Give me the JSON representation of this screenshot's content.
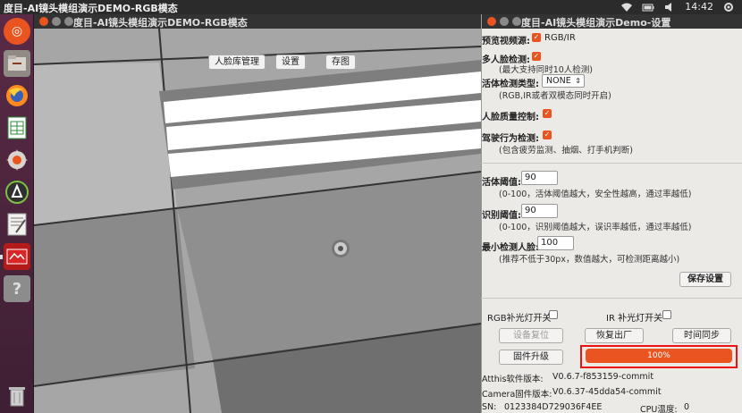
{
  "topbar": {
    "title": "度目-AI镜头模组演示DEMO-RGB模态",
    "clock": "14:42"
  },
  "cam_window": {
    "title": "度目-AI镜头模组演示DEMO-RGB模态",
    "buttons": {
      "face_db": "人脸库管理",
      "settings": "设置",
      "save_image": "存图"
    }
  },
  "settings_window": {
    "title": "度目-AI镜头模组演示Demo-设置",
    "preview_source_label": "预览视频源:",
    "preview_source_value": "RGB/IR",
    "multi_face_label": "多人脸检测:",
    "multi_face_hint": "(最大支持同时10人检测)",
    "liveness_type_label": "活体检测类型:",
    "liveness_type_value": "NONE",
    "liveness_type_hint": "(RGB,IR或者双模态同时开启)",
    "face_quality_label": "人脸质量控制:",
    "driving_label": "驾驶行为检测:",
    "driving_hint": "(包含疲劳监测、抽烟、打手机判断)",
    "liveness_threshold_label": "活体阈值:",
    "liveness_threshold_value": "90",
    "liveness_threshold_hint": "(0-100，活体阈值越大，安全性越高，通过率越低)",
    "recog_threshold_label": "识别阈值:",
    "recog_threshold_value": "90",
    "recog_threshold_hint": "(0-100，识别阈值越大，误识率越低，通过率越低)",
    "min_face_label": "最小检测人脸:",
    "min_face_value": "100",
    "min_face_hint": "(推荐不低于30px，数值越大，可检测距离越小)",
    "save_button": "保存设置",
    "rgb_light_label": "RGB补光灯开关",
    "ir_light_label": "IR 补光灯开关",
    "device_reset": "设备复位",
    "factory_reset": "恢复出厂",
    "time_sync": "时间同步",
    "firmware_upgrade": "固件升级",
    "progress_text": "100%",
    "progress_value": 1.0,
    "atthis_version_label": "Atthis软件版本:",
    "atthis_version_value": "V0.6.7-f853159-commit",
    "camera_version_label": "Camera固件版本:",
    "camera_version_value": "V0.6.37-45dda54-commit",
    "sn_label": "SN:",
    "sn_value": "0123384D729036F4EE",
    "cpu_temp_label": "CPU温度:",
    "cpu_temp_value": "0"
  },
  "colors": {
    "accent": "#e95420",
    "highlight_box": "#ee1111"
  }
}
